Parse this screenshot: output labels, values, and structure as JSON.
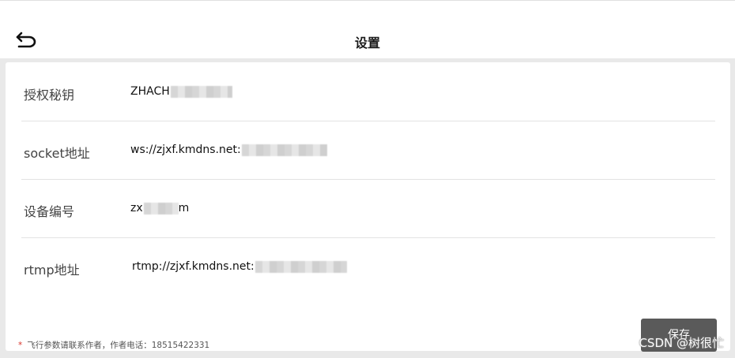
{
  "header": {
    "title": "设置"
  },
  "fields": [
    {
      "label": "授权秘钥",
      "value": "ZHACH"
    },
    {
      "label": "socket地址",
      "value": "ws://zjxf.kmdns.net:"
    },
    {
      "label": "设备编号",
      "value_pre": "zx",
      "value_post": "m"
    },
    {
      "label": "rtmp地址",
      "value": "rtmp://zjxf.kmdns.net:"
    }
  ],
  "footer": {
    "note_star": "*",
    "note_text": "飞行参数请联系作者，作者电话：18515422331",
    "save_label": "保存"
  },
  "watermark": "CSDN @树很忙",
  "icons": {
    "back": "back-arrow-icon"
  },
  "colors": {
    "save_button": "#5a5a5a",
    "background": "#e9e9e9",
    "star": "#d9342b"
  }
}
